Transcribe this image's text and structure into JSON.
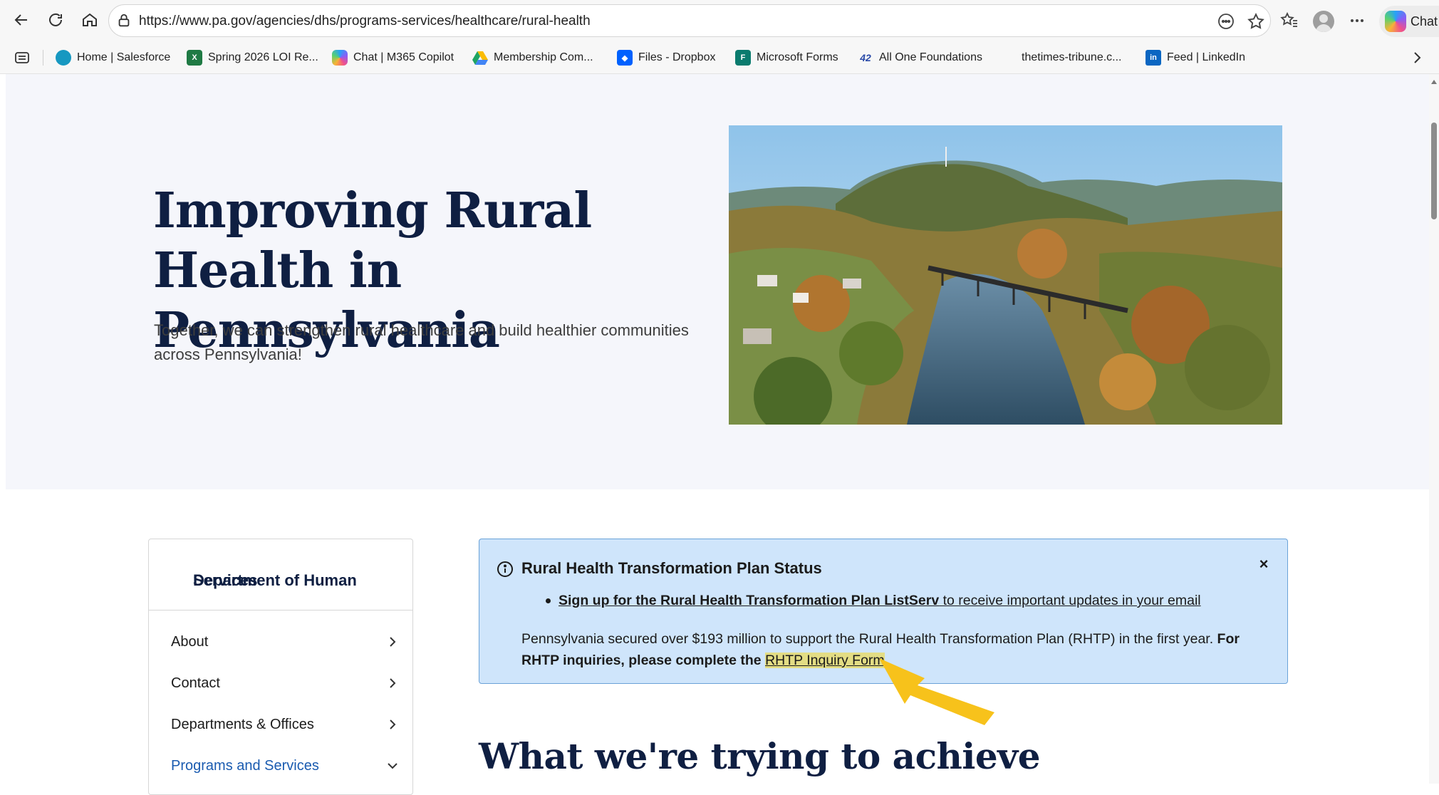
{
  "browser": {
    "url": "https://www.pa.gov/agencies/dhs/programs-services/healthcare/rural-health",
    "chat_label": "Chat"
  },
  "bookmarks": [
    {
      "label": "Home | Salesforce",
      "icon": "salesforce-icon",
      "color": "#1798c1"
    },
    {
      "label": "Spring 2026 LOI Re...",
      "icon": "excel-icon",
      "color": "#1f7a44"
    },
    {
      "label": "Chat | M365 Copilot",
      "icon": "copilot-icon",
      "color": "#8a5cf6"
    },
    {
      "label": "Membership Com...",
      "icon": "google-drive-icon",
      "color": "#fbbc04"
    },
    {
      "label": "Files - Dropbox",
      "icon": "dropbox-icon",
      "color": "#0061fe"
    },
    {
      "label": "Microsoft Forms",
      "icon": "forms-icon",
      "color": "#0a7b6e"
    },
    {
      "label": "All One Foundations",
      "icon": "foundation-icon",
      "color": "#2a4aa8"
    },
    {
      "label": "thetimes-tribune.c...",
      "icon": "",
      "color": ""
    },
    {
      "label": "Feed | LinkedIn",
      "icon": "linkedin-icon",
      "color": "#0a66c2"
    }
  ],
  "hero": {
    "title_line1": "Improving Rural",
    "title_line2": "Health in Pennsylvania",
    "subtitle_line1": "Together, we can strengthen rural healthcare and build healthier communities",
    "subtitle_line2": "across Pennsylvania!"
  },
  "sidenav": {
    "heading_line1": "Department of Human",
    "heading_line2": "Services",
    "items": [
      {
        "label": "About",
        "expanded": false
      },
      {
        "label": "Contact",
        "expanded": false
      },
      {
        "label": "Departments & Offices",
        "expanded": false
      },
      {
        "label": "Programs and Services",
        "expanded": true
      }
    ]
  },
  "alert": {
    "title": "Rural Health Transformation Plan Status",
    "close_symbol": "×",
    "bullet_link_bold": "Sign up for the Rural Health Transformation Plan ListServ",
    "bullet_link_rest": " to receive important updates in your email",
    "para_text": "Pennsylvania secured over $193 million to support the Rural Health Transformation Plan (RHTP) in the first year. ",
    "para_bold": "For RHTP inquiries, please complete the ",
    "para_link": "RHTP Inquiry Form",
    "para_end": "."
  },
  "section": {
    "title": "What we're trying to achieve"
  },
  "colors": {
    "heading": "#0f1f42",
    "alert_bg": "#cfe5fb",
    "alert_border": "#6aa2d8",
    "highlight": "#e3dd84",
    "arrow": "#f7c21b",
    "active_nav": "#1a5bb0"
  }
}
